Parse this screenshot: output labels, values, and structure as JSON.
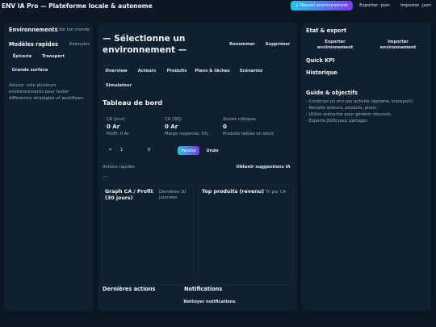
{
  "app": {
    "title": "ENV IA Pro — Plateforme locale & autonome",
    "new_env_label": "+ Nouvel environnement",
    "export_label": "Exporter .json",
    "import_label": "Importer .json"
  },
  "left": {
    "envs_title": "Environnements",
    "create_yours": "Crée ton monde",
    "models_title": "Modèles rapides",
    "examples": "Exemples",
    "templates": [
      {
        "label": "Épicerie"
      },
      {
        "label": "Transport"
      },
      {
        "label": "Grande surface"
      }
    ],
    "tip": "Astuce: crée plusieurs environnements pour tester différentes stratégies et workflows."
  },
  "main": {
    "title_line1": "— Sélectionne un",
    "title_line2": "environnement —",
    "rename_label": "Renommer",
    "delete_label": "Supprimer",
    "tabs": [
      {
        "label": "Overview"
      },
      {
        "label": "Acteurs"
      },
      {
        "label": "Produits"
      },
      {
        "label": "Plans & tâches"
      },
      {
        "label": "Scénarios"
      },
      {
        "label": "Simulateur"
      }
    ],
    "dashboard_title": "Tableau de bord",
    "kpis": [
      {
        "label": "CA (jour)",
        "value": "0 Ar",
        "sub": "Profit: 0 Ar"
      },
      {
        "label": "CA (30j)",
        "value": "0 Ar",
        "sub": "Marge moyenne: 0%"
      },
      {
        "label": "Stocks critiques",
        "value": "0",
        "sub": "Produits faibles en stock"
      }
    ],
    "stepper": {
      "chevron": "›",
      "qty": "1",
      "amount": "0",
      "sell_label": "Vendre",
      "undo_label": "Undo"
    },
    "quick_actions_label": "Actions rapides",
    "suggestions_label": "Obtenir suggestions IA",
    "dash": "—",
    "chart_left": {
      "title": "Graph CA / Profit (30 jours)",
      "note": "Dernières 30 journées"
    },
    "chart_right": {
      "title": "Top produits (revenu)",
      "note": "Tri par CA"
    },
    "last_actions_title": "Dernières actions",
    "notifications_title": "Notifications",
    "clear_notifications": "Nettoyer notifications"
  },
  "right": {
    "export_title": "Etat & export",
    "export_env_label": "Exporter environnement",
    "import_env_label": "Importer environnement",
    "quick_kpi": "Quick KPI",
    "history": "Historique",
    "guide_title": "Guide & objectifs",
    "guide_items": [
      "- Construis un env par activité (épicerie, transport).",
      "- Remplis acteurs, produits, plans.",
      "- Utilise scénarios pour générer discours.",
      "- Exporte JSON pour partager."
    ]
  },
  "colors": {
    "background": "#0b1722",
    "panel": "#0f212f",
    "accent_start": "#22c3ee",
    "accent_end": "#7c3aed"
  }
}
